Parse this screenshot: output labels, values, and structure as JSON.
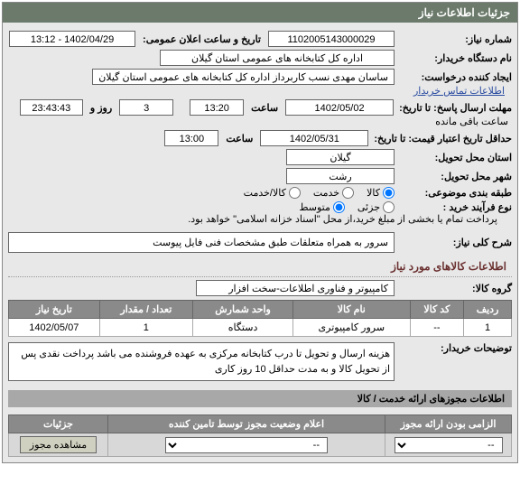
{
  "panel": {
    "title": "جزئیات اطلاعات نیاز"
  },
  "fields": {
    "need_no_label": "شماره نیاز:",
    "need_no": "1102005143000029",
    "announce_label": "تاریخ و ساعت اعلان عمومی:",
    "announce": "1402/04/29 - 13:12",
    "buyer_org_label": "نام دستگاه خریدار:",
    "buyer_org": "اداره کل کتابخانه های عمومی استان گیلان",
    "creator_label": "ایجاد کننده درخواست:",
    "creator": "ساسان مهدی نسب کاربرداز اداره کل کتابخانه های عمومی استان گیلان",
    "contact_link": "اطلاعات تماس خریدار",
    "deadline_label": "مهلت ارسال پاسخ: تا تاریخ:",
    "deadline_date": "1402/05/02",
    "time_label": "ساعت",
    "deadline_time": "13:20",
    "days_label": "روز و",
    "days_value": "3",
    "remain_time": "23:43:43",
    "remain_label": "ساعت باقی مانده",
    "validity_label": "حداقل تاریخ اعتبار قیمت: تا تاریخ:",
    "validity_date": "1402/05/31",
    "validity_time": "13:00",
    "province_label": "استان محل تحویل:",
    "province": "گیلان",
    "city_label": "شهر محل تحویل:",
    "city": "رشت",
    "category_label": "طبقه بندی موضوعی:",
    "cat_goods": "کالا",
    "cat_service": "خدمت",
    "cat_both": "کالا/خدمت",
    "process_label": "نوع فرآیند خرید :",
    "proc_partial": "جزئی",
    "proc_medium": "متوسط",
    "proc_note": "پرداخت تمام یا بخشی از مبلغ خرید،از محل \"اسناد خزانه اسلامی\" خواهد بود.",
    "general_desc_label": "شرح کلی نیاز:",
    "general_desc": "سرور به همراه متعلقات طبق مشخصات فنی فایل پیوست",
    "goods_info_title": "اطلاعات کالاهای مورد نیاز",
    "group_label": "گروه کالا:",
    "group": "کامپیوتر و فناوری اطلاعات-سخت افزار",
    "buyer_notes_label": "توضیحات خریدار:",
    "buyer_notes": "هزینه ارسال و تحویل تا درب کتابخانه مرکزی به عهده فروشنده می باشد پرداخت نقدی پس از تحویل کالا و به مدت حداقل 10 روز کاری"
  },
  "goods_table": {
    "headers": {
      "row": "ردیف",
      "code": "کد کالا",
      "name": "نام کالا",
      "unit": "واحد شمارش",
      "qty": "تعداد / مقدار",
      "date": "تاریخ نیاز"
    },
    "rows": [
      {
        "row": "1",
        "code": "--",
        "name": "سرور کامپیوتری",
        "unit": "دستگاه",
        "qty": "1",
        "date": "1402/05/07"
      }
    ]
  },
  "sub_panel": {
    "title": "اطلاعات مجوزهای ارائه خدمت / کالا"
  },
  "bottom_table": {
    "headers": {
      "mandatory": "الزامی بودن ارائه مجوز",
      "status": "اعلام وضعیت مجوز توسط تامین کننده",
      "details": "جزئیات"
    },
    "row": {
      "select1": "--",
      "select2": "--",
      "btn": "مشاهده مجوز"
    }
  }
}
